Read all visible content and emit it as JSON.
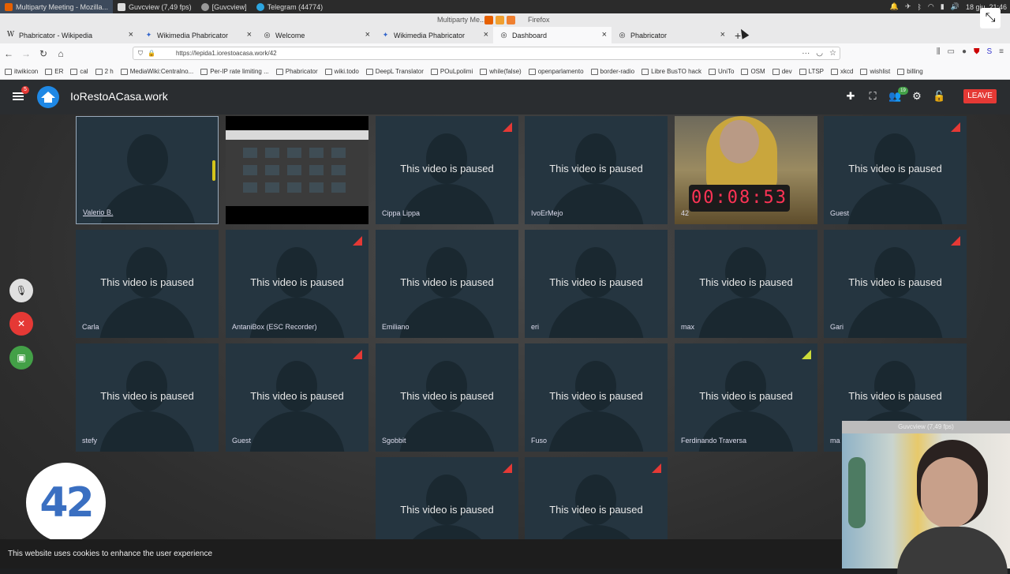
{
  "taskbar": {
    "tasks": [
      {
        "label": "Multiparty Meeting - Mozilla..."
      },
      {
        "label": "Guvcview (7,49 fps)"
      },
      {
        "label": "[Guvcview]"
      },
      {
        "label": "Telegram (44774)"
      }
    ],
    "clock": "18 giu, 21:46"
  },
  "window": {
    "title": "Multiparty Me...",
    "app": "Firefox"
  },
  "tabs": [
    {
      "label": "Phabricator - Wikipedia",
      "icon": "wikipedia-icon"
    },
    {
      "label": "Wikimedia Phabricator",
      "icon": "phabricator-icon"
    },
    {
      "label": "Welcome",
      "icon": "globe-icon"
    },
    {
      "label": "Wikimedia Phabricator",
      "icon": "phabricator-icon"
    },
    {
      "label": "Dashboard",
      "icon": "globe-icon"
    },
    {
      "label": "Phabricator",
      "icon": "globe-icon"
    }
  ],
  "url": "https://lepida1.iorestoacasa.work/42",
  "bookmarks": [
    "itwikicon",
    "ER",
    "cal",
    "2 h",
    "MediaWiki:Centralno...",
    "Per-IP rate limiting ...",
    "Phabricator",
    "wiki.todo",
    "DeepL Translator",
    "POuLpolimi",
    "while(false)",
    "openparlamento",
    "border-radio",
    "Libre BusTO hack",
    "UniTo",
    "OSM",
    "dev",
    "LTSP",
    "xkcd",
    "wishlist",
    "billing"
  ],
  "header": {
    "site_name": "IoRestoACasa.work",
    "menu_badge": "5",
    "participants_badge": "19",
    "leave_label": "LEAVE"
  },
  "paused_text": "This video is paused",
  "participants": [
    {
      "name": "Valerio B.",
      "paused": false
    },
    {
      "name": "",
      "paused": false
    },
    {
      "name": "Cippa Lippa",
      "paused": true
    },
    {
      "name": "IvoErMejo",
      "paused": true
    },
    {
      "name": "42",
      "paused": false
    },
    {
      "name": "Guest",
      "paused": true
    },
    {
      "name": "Carla",
      "paused": true
    },
    {
      "name": "AntaniBox (ESC Recorder)",
      "paused": true
    },
    {
      "name": "Emiliano",
      "paused": true
    },
    {
      "name": "eri",
      "paused": true
    },
    {
      "name": "max",
      "paused": true
    },
    {
      "name": "Gari",
      "paused": true
    },
    {
      "name": "stefy",
      "paused": true
    },
    {
      "name": "Guest",
      "paused": true
    },
    {
      "name": "Sgobbit",
      "paused": true
    },
    {
      "name": "Fuso",
      "paused": true
    },
    {
      "name": "Ferdinando Traversa",
      "paused": true
    },
    {
      "name": "ma",
      "paused": true
    },
    {
      "name": "",
      "paused": true
    },
    {
      "name": "",
      "paused": true
    }
  ],
  "clock_display": "00:08:53",
  "logo_text": "42",
  "cookie_text": "This website uses cookies to enhance the user experience",
  "guvcview_title": "Guvcview (7,49 fps)",
  "colors": {
    "accent_red": "#e53935",
    "accent_green": "#43a047",
    "tile_bg": "#253540"
  }
}
